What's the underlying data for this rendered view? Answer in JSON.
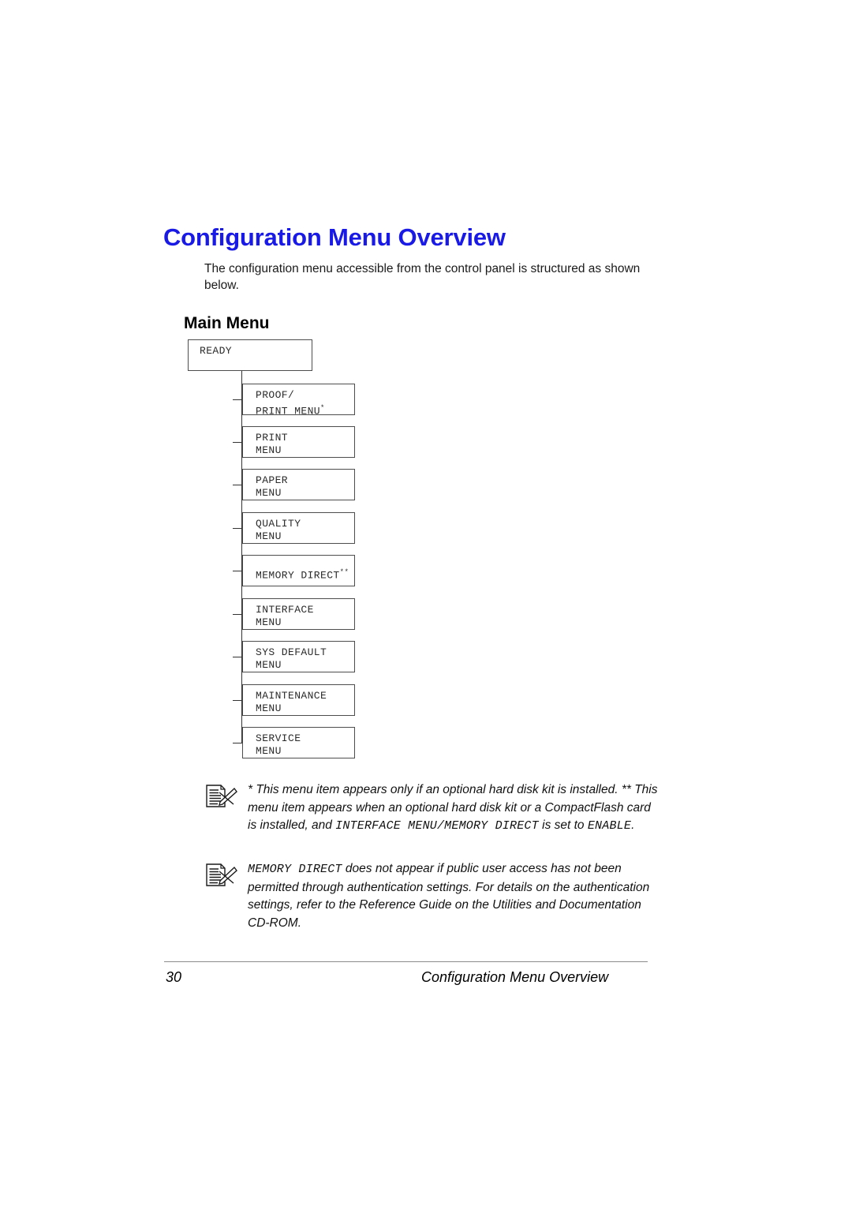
{
  "document": {
    "title": "Configuration Menu Overview",
    "intro": "The configuration menu accessible from the control panel is structured as shown below.",
    "sub_heading": "Main Menu"
  },
  "diagram": {
    "root": {
      "label": "READY"
    },
    "children": [
      {
        "line1": "PROOF/",
        "line2": "PRINT MENU",
        "marker": "*"
      },
      {
        "line1": "PRINT",
        "line2": "MENU",
        "marker": ""
      },
      {
        "line1": "PAPER",
        "line2": "MENU",
        "marker": ""
      },
      {
        "line1": "QUALITY",
        "line2": "MENU",
        "marker": ""
      },
      {
        "line1": "MEMORY DIRECT",
        "line2": "",
        "marker": "**"
      },
      {
        "line1": "INTERFACE",
        "line2": "MENU",
        "marker": ""
      },
      {
        "line1": "SYS DEFAULT",
        "line2": "MENU",
        "marker": ""
      },
      {
        "line1": "MAINTENANCE",
        "line2": "MENU",
        "marker": ""
      },
      {
        "line1": "SERVICE",
        "line2": "MENU",
        "marker": ""
      }
    ]
  },
  "notes": [
    {
      "icon": "note-pencil-icon",
      "part1": "* This menu item appears only if an optional hard disk kit is installed. ** This menu item appears when an optional hard disk kit or a CompactFlash card is installed, and ",
      "mono1": "INTERFACE MENU/MEMORY DIRECT",
      "part2": " is set to ",
      "mono2": "ENABLE",
      "part3": "."
    },
    {
      "icon": "note-pencil-icon",
      "mono1": "MEMORY DIRECT",
      "part2": " does not appear if public user access has not been permitted through authentication settings. For details on the authentication settings, refer to the Reference Guide on the Utilities and Documentation CD-ROM.",
      "part1": "",
      "mono2": "",
      "part3": ""
    }
  ],
  "footer": {
    "page_number": "30",
    "title": "Configuration Menu Overview"
  },
  "colors": {
    "heading_blue": "#1a1ae6",
    "box_border": "#4d4d4d",
    "rule_gray": "#8c8c8c"
  }
}
